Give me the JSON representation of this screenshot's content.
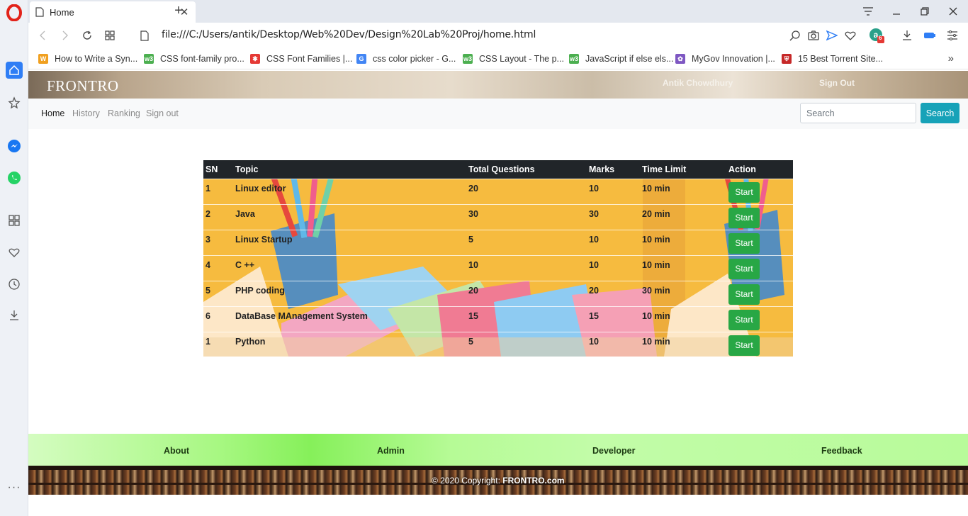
{
  "browser": {
    "tab_title": "Home",
    "url": "file:///C:/Users/antik/Desktop/Web%20Dev/Design%20Lab%20Proj/home.html",
    "extension_badge": "6",
    "bookmarks": [
      {
        "label": "How to Write a Syn...",
        "icon": "w-icon",
        "color": "#f0a020",
        "glyph": "W"
      },
      {
        "label": "CSS font-family pro...",
        "icon": "w3-icon",
        "color": "#4caf50",
        "glyph": "w3"
      },
      {
        "label": "CSS Font Families |...",
        "icon": "snowflake-icon",
        "color": "#e53935",
        "glyph": "✱"
      },
      {
        "label": "css color picker - G...",
        "icon": "google-icon",
        "color": "#4285f4",
        "glyph": "G"
      },
      {
        "label": "CSS Layout - The p...",
        "icon": "w3-icon",
        "color": "#4caf50",
        "glyph": "w3"
      },
      {
        "label": "JavaScript if else els...",
        "icon": "w3-icon",
        "color": "#4caf50",
        "glyph": "w3"
      },
      {
        "label": "MyGov Innovation |...",
        "icon": "mygov-icon",
        "color": "#7e57c2",
        "glyph": "✿"
      },
      {
        "label": "15 Best Torrent Site...",
        "icon": "shield-icon",
        "color": "#c62828",
        "glyph": "⛨"
      }
    ]
  },
  "site": {
    "logo": "FRONTRO",
    "user_name": "Antik Chowdhury",
    "sign_out_top": "Sign Out",
    "nav": [
      {
        "label": "Home",
        "active": true
      },
      {
        "label": "History",
        "active": false
      },
      {
        "label": "Ranking",
        "active": false
      },
      {
        "label": "Sign out",
        "active": false
      }
    ],
    "search_placeholder": "Search",
    "search_button": "Search"
  },
  "quiz_table": {
    "headers": [
      "SN",
      "Topic",
      "Total Questions",
      "Marks",
      "Time Limit",
      "Action"
    ],
    "rows": [
      {
        "sn": "1",
        "topic": "Linux editor",
        "questions": "20",
        "marks": "10",
        "time": "10 min",
        "action": "Start"
      },
      {
        "sn": "2",
        "topic": "Java",
        "questions": "30",
        "marks": "30",
        "time": "20 min",
        "action": "Start"
      },
      {
        "sn": "3",
        "topic": "Linux Startup",
        "questions": "5",
        "marks": "10",
        "time": "10 min",
        "action": "Start"
      },
      {
        "sn": "4",
        "topic": "C ++",
        "questions": "10",
        "marks": "10",
        "time": "10 min",
        "action": "Start"
      },
      {
        "sn": "5",
        "topic": "PHP coding",
        "questions": "20",
        "marks": "20",
        "time": "30 min",
        "action": "Start"
      },
      {
        "sn": "6",
        "topic": "DataBase MAnagement System",
        "questions": "15",
        "marks": "15",
        "time": "10 min",
        "action": "Start"
      },
      {
        "sn": "1",
        "topic": "Python",
        "questions": "5",
        "marks": "10",
        "time": "10 min",
        "action": "Start"
      }
    ]
  },
  "footer": {
    "links": [
      "About",
      "Admin",
      "Developer",
      "Feedback"
    ],
    "copyright_prefix": "© 2020 Copyright: ",
    "copyright_brand": "FRONTRO.com"
  },
  "colors": {
    "opera_red": "#e2231a",
    "nav_active": "#2f7ef5",
    "search_button": "#17a2b8",
    "start_button": "#28a745",
    "table_header": "#212529"
  }
}
